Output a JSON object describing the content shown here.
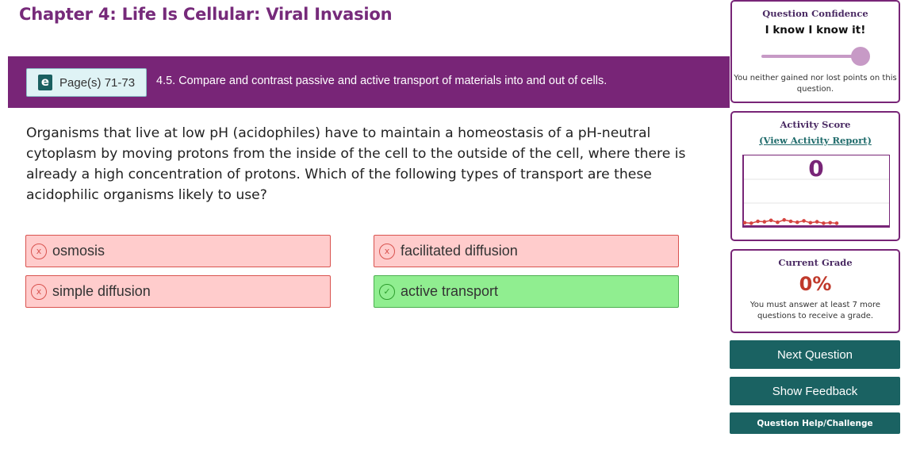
{
  "chapter_title": "Chapter 4: Life Is Cellular: Viral Invasion",
  "banner": {
    "ebook_icon": "ebook-icon",
    "ebook_icon_glyph": "e",
    "pages_label": "Page(s) 71-73",
    "objective": "4.5. Compare and contrast passive and active transport of materials into and out of cells."
  },
  "question": {
    "text": "Organisms that live at low pH (acidophiles) have to maintain a homeostasis of a pH-neutral cytoplasm by moving protons from the inside of the cell to the outside of the cell, where there is already a high concentration of protons. Which of the following types of transport are these acidophilic organisms likely to use?"
  },
  "answers": [
    {
      "label": "osmosis",
      "status": "incorrect",
      "icon": "x-circle-icon",
      "icon_glyph": "x"
    },
    {
      "label": "facilitated diffusion",
      "status": "incorrect",
      "icon": "x-circle-icon",
      "icon_glyph": "x"
    },
    {
      "label": "simple diffusion",
      "status": "incorrect",
      "icon": "x-circle-icon",
      "icon_glyph": "x"
    },
    {
      "label": "active transport",
      "status": "correct",
      "icon": "check-circle-icon",
      "icon_glyph": "✓"
    }
  ],
  "confidence": {
    "heading": "Question Confidence",
    "value": "I know I know it!",
    "slider_level": 1.0,
    "note": "You neither gained nor lost points on this question."
  },
  "activity": {
    "heading": "Activity Score",
    "report_link": "(View Activity Report)",
    "score": "0",
    "sparkline_values": [
      0.02,
      0.01,
      0.05,
      0.04,
      0.07,
      0.03,
      0.08,
      0.05,
      0.03,
      0.06,
      0.02,
      0.04,
      0.01,
      0.02,
      0.01
    ]
  },
  "grade": {
    "heading": "Current Grade",
    "value": "0%",
    "note": "You must answer at least 7 more questions to receive a grade."
  },
  "buttons": {
    "next": "Next Question",
    "feedback": "Show Feedback",
    "help": "Question Help/Challenge"
  },
  "colors": {
    "brand_purple": "#782577",
    "teal_button": "#1a6262",
    "incorrect_bg": "#ffcccc",
    "correct_bg": "#90ee90",
    "grade_red": "#c0392b"
  }
}
